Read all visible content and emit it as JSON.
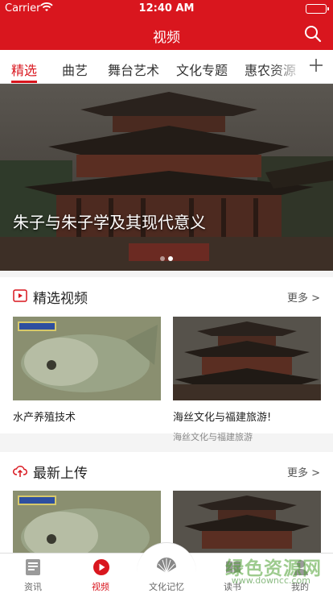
{
  "status_bar": {
    "carrier": "Carrier",
    "time": "12:40 AM",
    "battery_level": 1.0
  },
  "nav": {
    "title": "视频",
    "search_icon": "search-icon"
  },
  "tabs": [
    {
      "label": "精选",
      "active": true
    },
    {
      "label": "曲艺"
    },
    {
      "label": "舞台艺术"
    },
    {
      "label": "文化专题"
    },
    {
      "label": "惠农资源"
    }
  ],
  "tab_add_icon": "plus-icon",
  "banner": {
    "caption": "朱子与朱子学及其现代意义",
    "slide_count": 2,
    "active_slide": 1
  },
  "sections": [
    {
      "title": "精选视频",
      "icon": "play-square-icon",
      "more": "更多 >",
      "cards": [
        {
          "title": "水产养殖技术",
          "subtitle": ""
        },
        {
          "title": "海丝文化与福建旅游!",
          "subtitle": "海丝文化与福建旅游"
        }
      ]
    },
    {
      "title": "最新上传",
      "icon": "cloud-upload-icon",
      "more": "更多 >",
      "cards": [
        {
          "title": "",
          "subtitle": ""
        },
        {
          "title": "",
          "subtitle": ""
        }
      ]
    }
  ],
  "tabbar": [
    {
      "label": "资讯",
      "icon": "news-icon"
    },
    {
      "label": "视频",
      "icon": "play-circle-icon",
      "active": true
    },
    {
      "label": "文化记忆",
      "icon": "fan-icon"
    },
    {
      "label": "读书",
      "icon": "book-icon"
    },
    {
      "label": "我的",
      "icon": "user-icon"
    }
  ],
  "watermark": {
    "main": "绿色资源网",
    "sub": "www.downcc.com"
  },
  "colors": {
    "brand_red": "#d9161e",
    "battery_green": "#4cd964"
  }
}
